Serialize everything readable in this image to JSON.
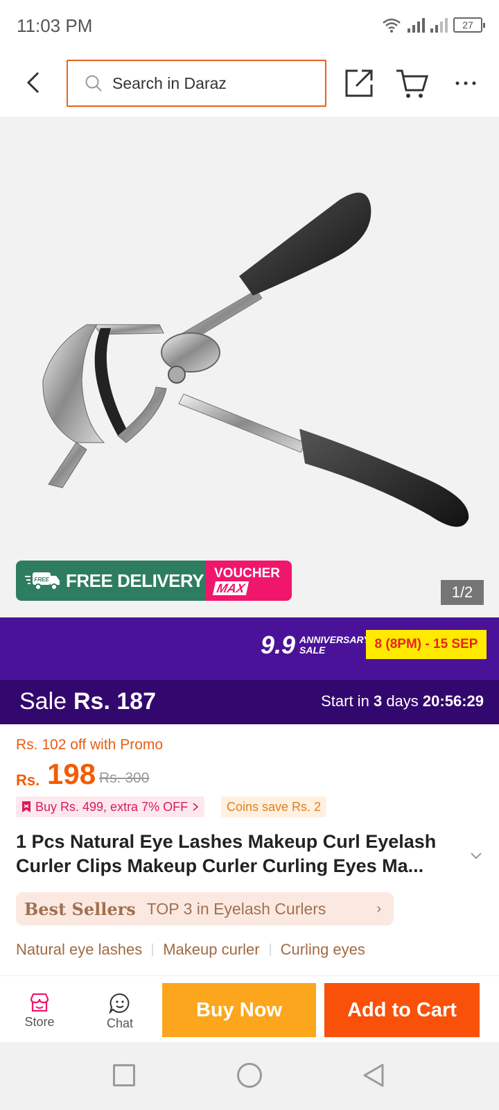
{
  "status_bar": {
    "time": "11:03 PM",
    "battery": "27"
  },
  "header": {
    "search_placeholder": "Search in Daraz"
  },
  "gallery": {
    "counter": "1/2",
    "promo": {
      "free_delivery": "FREE DELIVERY",
      "free_badge": "FREE",
      "voucher_top": "VOUCHER",
      "voucher_bottom": "MAX"
    }
  },
  "campaign": {
    "number": "9.9",
    "line1": "ANNIVERSARY",
    "line2": "SALE",
    "date": "8 (8PM) - 15 SEP"
  },
  "sale": {
    "label": "Sale",
    "price": "Rs. 187",
    "countdown_prefix": "Start in",
    "countdown_days": "3",
    "countdown_days_label": "days",
    "countdown_time": "20:56:29"
  },
  "price": {
    "promo_text": "Rs. 102 off with Promo",
    "currency": "Rs.",
    "value": "198",
    "original": "Rs. 300"
  },
  "deals": {
    "buy_more": "Buy Rs. 499, extra 7% OFF",
    "coins": "Coins save Rs. 2"
  },
  "product": {
    "title": "1 Pcs Natural Eye Lashes Makeup Curl Eyelash Curler Clips Makeup Curler Curling Eyes Ma..."
  },
  "bestseller": {
    "label": "Best Sellers",
    "rank": "TOP 3 in Eyelash Curlers"
  },
  "tags": [
    "Natural eye lashes",
    "Makeup curler",
    "Curling eyes"
  ],
  "bottom_bar": {
    "store": "Store",
    "chat": "Chat",
    "buy_now": "Buy Now",
    "add_to_cart": "Add to Cart"
  },
  "colors": {
    "brand_orange": "#f25c05",
    "campaign_purple": "#4a1299",
    "buy_now": "#fca61d",
    "add_to_cart": "#f9510a"
  }
}
